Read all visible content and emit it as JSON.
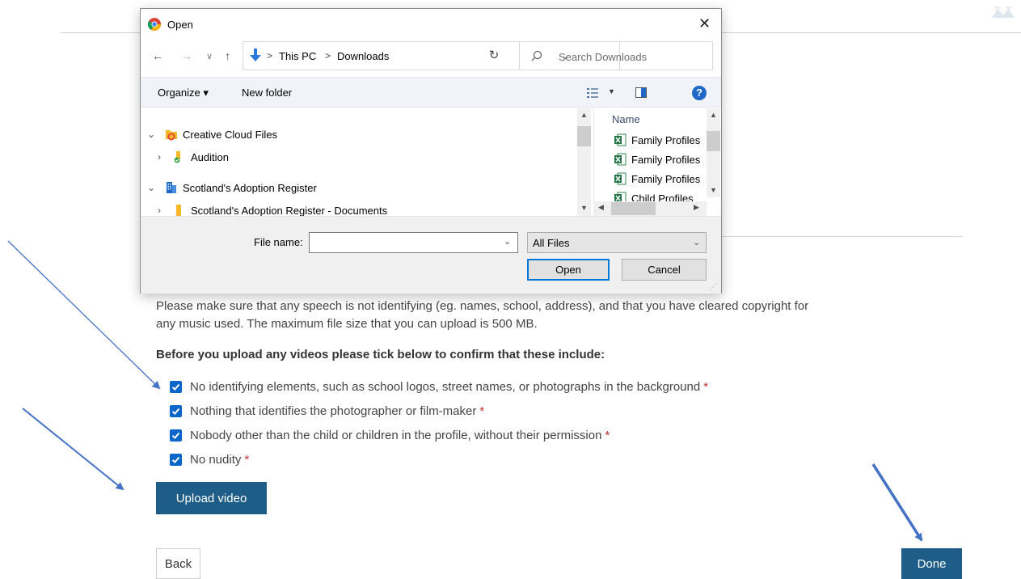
{
  "page": {
    "intro_line1": "Please make sure that any speech is not identifying (eg. names, school, address), and that you have cleared copyright for",
    "intro_line2": "any music used. The maximum file size that you can upload is 500 MB.",
    "confirm_heading": "Before you upload any videos please tick below to confirm that these include:",
    "checkboxes": [
      {
        "label": "No identifying elements, such as school logos, street names, or photographs in the background",
        "checked": true,
        "required_mark": "*"
      },
      {
        "label": "Nothing that identifies the photographer or film-maker",
        "checked": true,
        "required_mark": "*"
      },
      {
        "label": "Nobody other than the child or children in the profile, without their permission",
        "checked": true,
        "required_mark": "*"
      },
      {
        "label": "No nudity",
        "checked": true,
        "required_mark": "*"
      }
    ],
    "upload_button": "Upload video",
    "back_button": "Back",
    "done_button": "Done",
    "colors": {
      "primary_button": "#1e5d87",
      "checkbox": "#0a66c8",
      "required": "#c9302c",
      "annotation_arrow": "#4472c4"
    }
  },
  "dialog": {
    "title": "Open",
    "close_glyph": "✕",
    "nav": {
      "back_glyph": "←",
      "forward_glyph": "→",
      "recent_glyph": "∨",
      "up_glyph": "↑",
      "refresh_glyph": "↻"
    },
    "breadcrumb": [
      "This PC",
      "Downloads"
    ],
    "breadcrumb_sep": ">",
    "search_placeholder": "Search Downloads",
    "toolbar": {
      "organize": "Organize ▾",
      "new_folder": "New folder",
      "help": "?"
    },
    "tree": [
      {
        "label": "Creative Cloud Files",
        "expanded": true,
        "icon": "creative-cloud-folder-icon"
      },
      {
        "label": "Audition",
        "expanded": false,
        "icon": "synced-folder-icon"
      },
      {
        "label": "Scotland's Adoption Register",
        "expanded": true,
        "icon": "building-icon"
      },
      {
        "label": "Scotland's Adoption Register - Documents",
        "expanded": false,
        "icon": "folder-icon"
      }
    ],
    "files_header": "Name",
    "files": [
      "Family Profiles",
      "Family Profiles",
      "Family Profiles",
      "Child Profiles"
    ],
    "file_name_label": "File name:",
    "file_name_value": "",
    "file_type": "All Files",
    "open_button": "Open",
    "cancel_button": "Cancel"
  }
}
